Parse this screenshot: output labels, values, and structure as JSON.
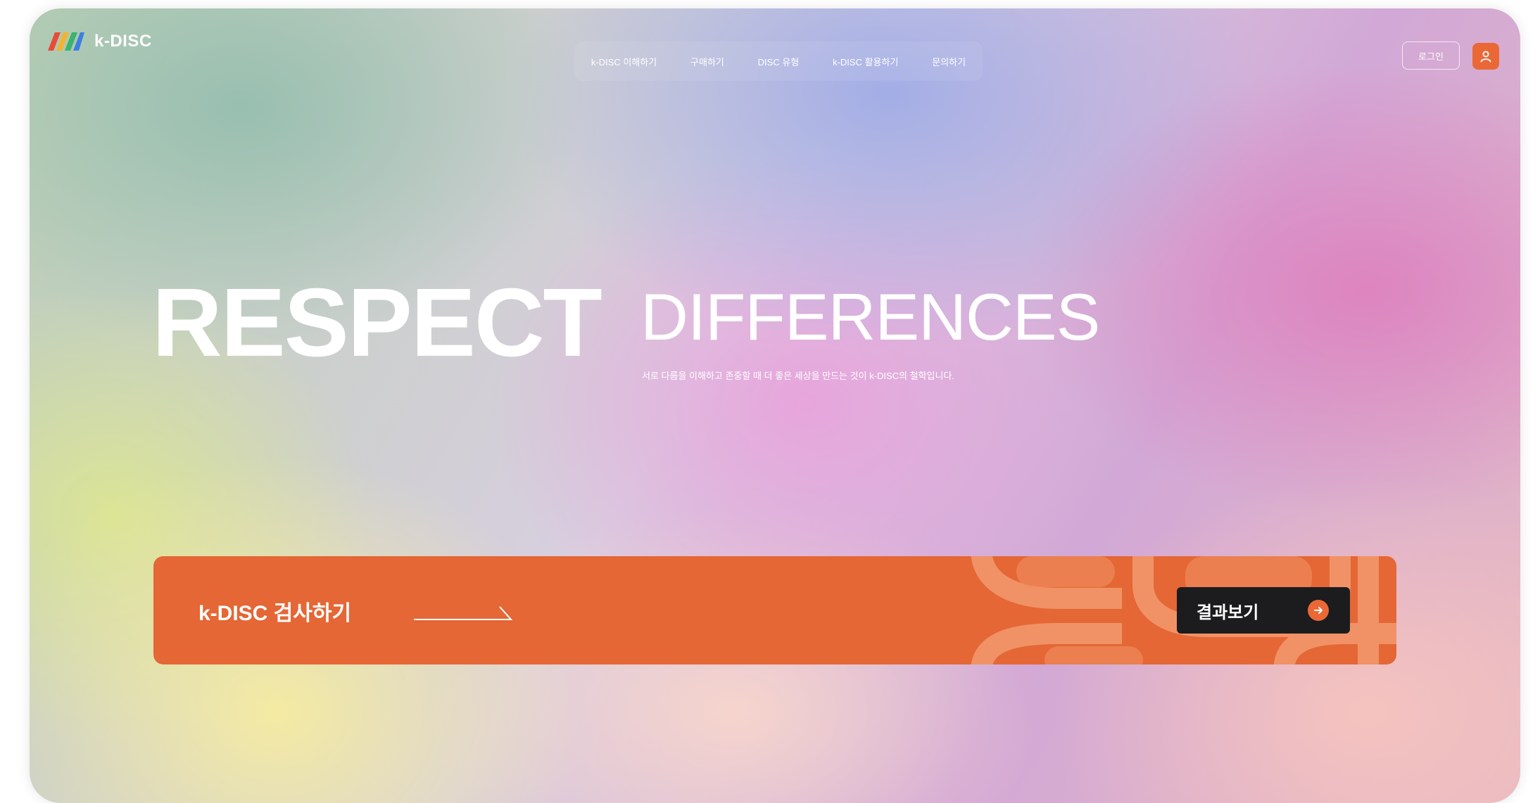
{
  "header": {
    "brand": "k-DISC",
    "nav": [
      {
        "label": "k-DISC 이해하기"
      },
      {
        "label": "구매하기"
      },
      {
        "label": "DISC 유형"
      },
      {
        "label": "k-DISC 활용하기"
      },
      {
        "label": "문의하기"
      }
    ],
    "login_label": "로그인",
    "user_icon": "user-icon"
  },
  "hero": {
    "title_bold": "RESPECT",
    "title_light": "DIFFERENCES",
    "subtitle": "서로 다름을 이해하고 존중할 때 더 좋은 세상을 만드는 것이 k-DISC의 철학입니다."
  },
  "cta": {
    "label": "k-DISC 검사하기",
    "result_button": "결과보기",
    "arrow_icon": "arrow-right-icon"
  },
  "colors": {
    "accent": "#e46735",
    "button_dark": "#1c1c1e",
    "text_light": "#ffffff"
  }
}
